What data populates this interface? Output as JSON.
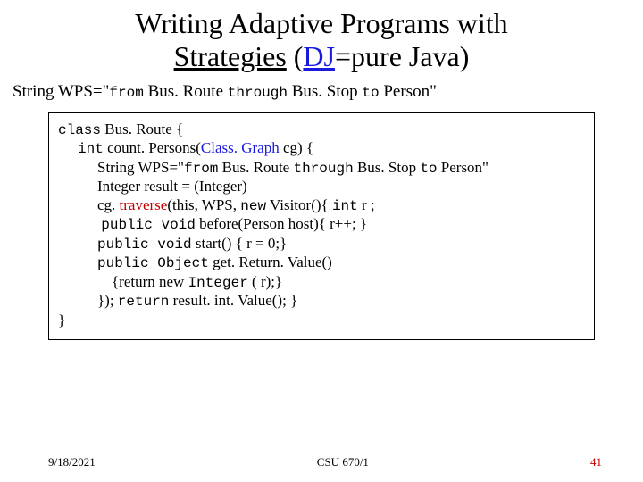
{
  "title": {
    "line1": "Writing Adaptive Programs with",
    "line2_a": "Strategies",
    "line2_b": " (",
    "line2_c": "DJ",
    "line2_d": "=pure Java)"
  },
  "subtitle": {
    "t1": "String WPS=\"",
    "t2": "from",
    "t3": " Bus. Route ",
    "t4": "through",
    "t5": " Bus. Stop ",
    "t6": "to",
    "t7": " Person\""
  },
  "code": {
    "l1a": "class",
    "l1b": " Bus. Route {",
    "l2a": "int",
    "l2b": " count. Persons(",
    "l2c": "Class. Graph",
    "l2d": " cg) {",
    "l3a": "String WPS=\"",
    "l3b": "from",
    "l3c": " Bus. Route ",
    "l3d": "through",
    "l3e": " Bus. Stop ",
    "l3f": "to",
    "l3g": " Person\"",
    "l4": "Integer result = (Integer)",
    "l5a": "cg. ",
    "l5b": "traverse",
    "l5c": "(this, WPS, ",
    "l5d": "new",
    "l5e": "  Visitor(){ ",
    "l5f": "int",
    "l5g": " r ;",
    "l6a": "public void",
    "l6b": " before(Person host){ r++; }",
    "l7a": "public void",
    "l7b": " start() { r = 0;}",
    "l8a": "public Object",
    "l8b": " get. Return. Value()",
    "l9a": "{return new ",
    "l9b": "Integer",
    "l9c": " ( r);}",
    "l10a": "}); ",
    "l10b": "return",
    "l10c": " result. int. Value(); }",
    "l11": "}"
  },
  "footer": {
    "date": "9/18/2021",
    "course": "CSU 670/1",
    "page": "41"
  }
}
